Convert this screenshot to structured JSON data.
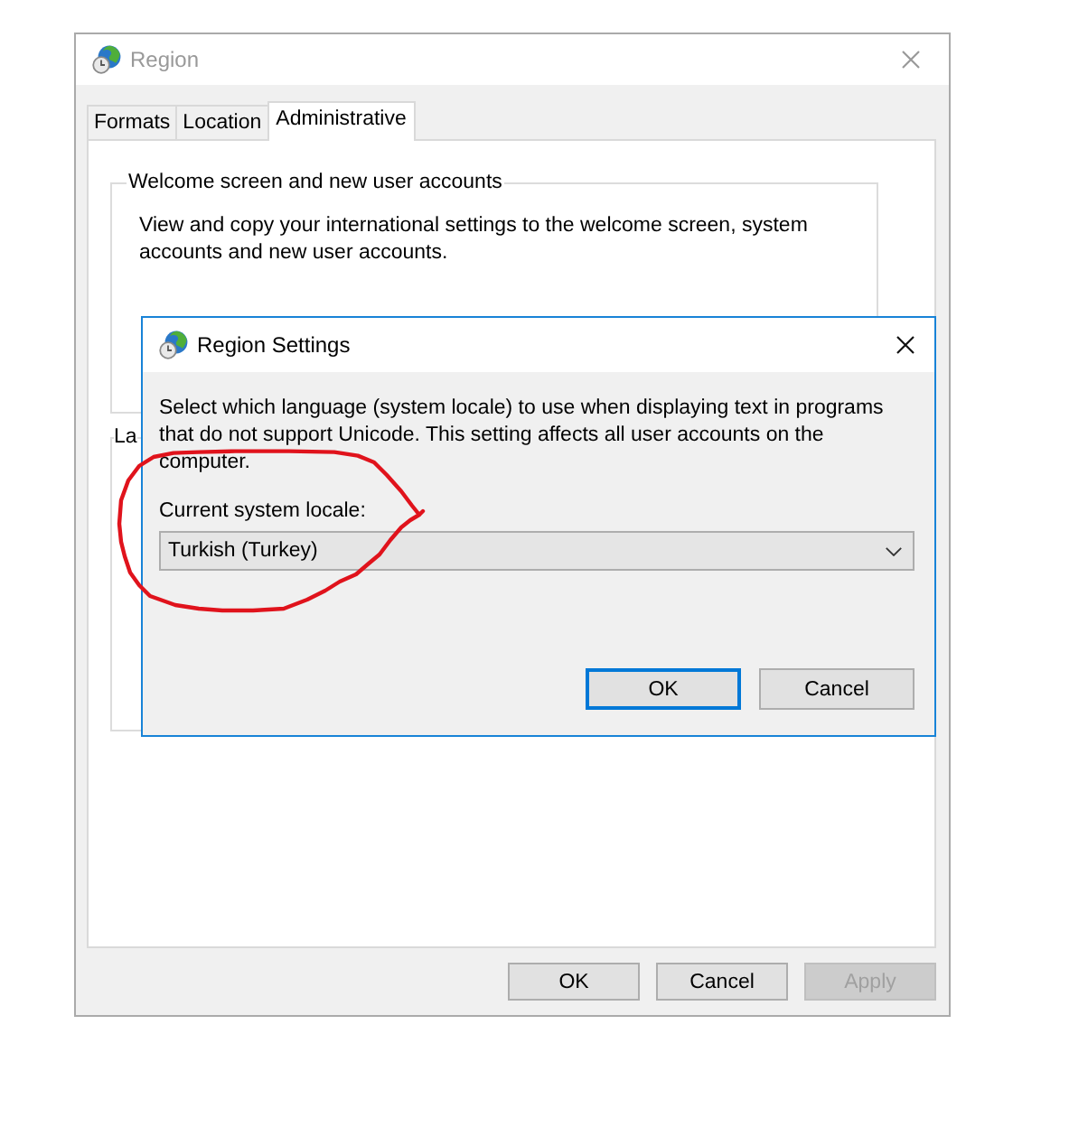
{
  "window": {
    "title": "Region",
    "active": false
  },
  "tabs": [
    {
      "label": "Formats",
      "selected": false
    },
    {
      "label": "Location",
      "selected": false
    },
    {
      "label": "Administrative",
      "selected": true
    }
  ],
  "groups": [
    {
      "legend": "Welcome screen and new user accounts",
      "text": "View and copy your international settings to the welcome screen, system accounts and new user accounts."
    },
    {
      "legend": "La"
    }
  ],
  "buttons": [
    {
      "label": "OK",
      "disabled": false
    },
    {
      "label": "Cancel",
      "disabled": false
    },
    {
      "label": "Apply",
      "disabled": true
    }
  ],
  "dialog": {
    "title": "Region Settings",
    "active": true,
    "description": "Select which language (system locale) to use when displaying text in programs that do not support Unicode. This setting affects all user accounts on the computer.",
    "locale_label": "Current system locale:",
    "locale": {
      "value": "Turkish (Turkey)"
    },
    "buttons": [
      {
        "label": "OK",
        "default": true
      },
      {
        "label": "Cancel",
        "default": false
      }
    ]
  }
}
